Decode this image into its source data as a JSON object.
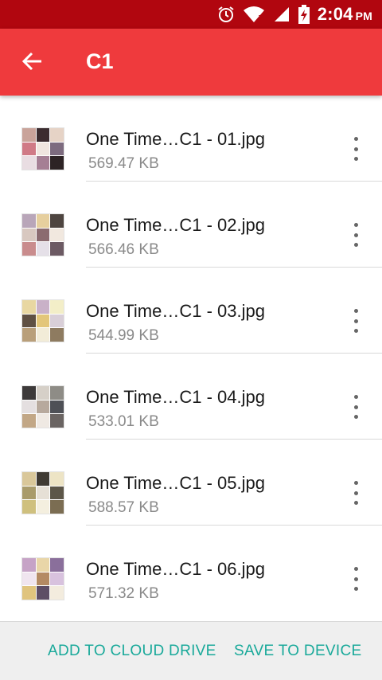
{
  "status_bar": {
    "time": "2:04",
    "ampm": "PM",
    "icons": [
      "alarm-icon",
      "wifi-icon",
      "signal-icon",
      "battery-charging-icon"
    ]
  },
  "app_bar": {
    "back_icon": "arrow-left-icon",
    "title": "C1"
  },
  "files": [
    {
      "name": "One Time…C1 - 01.jpg",
      "size": "569.47 KB"
    },
    {
      "name": "One Time…C1 - 02.jpg",
      "size": "566.46 KB"
    },
    {
      "name": "One Time…C1 - 03.jpg",
      "size": "544.99 KB"
    },
    {
      "name": "One Time…C1 - 04.jpg",
      "size": "533.01 KB"
    },
    {
      "name": "One Time…C1 - 05.jpg",
      "size": "588.57 KB"
    },
    {
      "name": "One Time…C1 - 06.jpg",
      "size": "571.32 KB"
    }
  ],
  "bottom_bar": {
    "add_to_cloud_label": "ADD TO CLOUD DRIVE",
    "save_to_device_label": "SAVE TO DEVICE"
  },
  "colors": {
    "status_bar": "#b1060f",
    "app_bar": "#ef3a3d",
    "accent": "#19a99a"
  }
}
